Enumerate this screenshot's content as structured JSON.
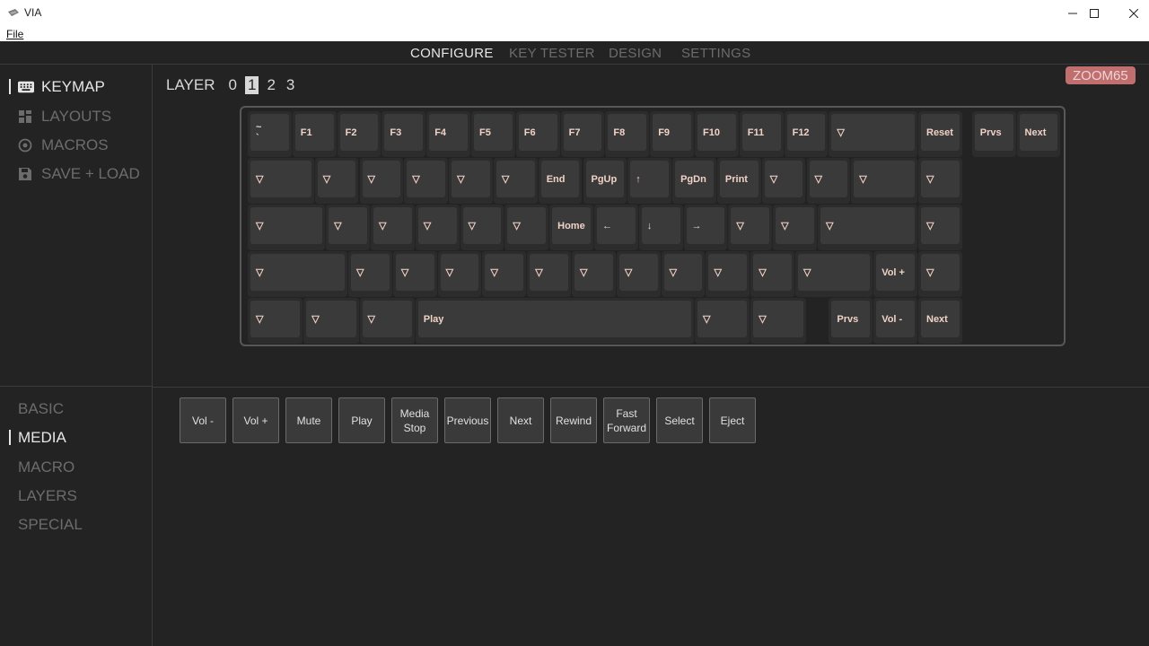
{
  "window": {
    "title": "VIA",
    "minimize": "—",
    "maximize": "☐",
    "close": "✕"
  },
  "menu": {
    "file": "File"
  },
  "topnav": [
    {
      "label": "CONFIGURE",
      "active": true
    },
    {
      "label": "KEY TESTER",
      "active": false
    },
    {
      "label": "DESIGN",
      "active": false
    },
    {
      "label": "SETTINGS",
      "active": false
    }
  ],
  "sidebar_top": [
    {
      "label": "KEYMAP",
      "icon": "keyboard-icon",
      "active": true
    },
    {
      "label": "LAYOUTS",
      "icon": "grid-icon",
      "active": false
    },
    {
      "label": "MACROS",
      "icon": "record-icon",
      "active": false
    },
    {
      "label": "SAVE + LOAD",
      "icon": "floppy-disk-icon",
      "active": false
    }
  ],
  "sidebar_bottom": [
    {
      "label": "BASIC",
      "active": false
    },
    {
      "label": "MEDIA",
      "active": true
    },
    {
      "label": "MACRO",
      "active": false
    },
    {
      "label": "LAYERS",
      "active": false
    },
    {
      "label": "SPECIAL",
      "active": false
    }
  ],
  "layer": {
    "label": "LAYER",
    "numbers": [
      "0",
      "1",
      "2",
      "3"
    ],
    "selected": "1"
  },
  "keyboard_name": "ZOOM65",
  "keyboard": {
    "rows": [
      [
        "~\n`",
        "F1",
        "F2",
        "F3",
        "F4",
        "F5",
        "F6",
        "F7",
        "F8",
        "F9",
        "F10",
        "F11",
        "F12",
        "▽",
        "Reset",
        "Prvs",
        "Next"
      ],
      [
        "▽",
        "▽",
        "▽",
        "▽",
        "▽",
        "▽",
        "End",
        "PgUp",
        "↑",
        "PgDn",
        "Print",
        "▽",
        "▽",
        "▽",
        "▽"
      ],
      [
        "▽",
        "▽",
        "▽",
        "▽",
        "▽",
        "▽",
        "Home",
        "←",
        "↓",
        "→",
        "▽",
        "▽",
        "▽",
        "▽"
      ],
      [
        "▽",
        "▽",
        "▽",
        "▽",
        "▽",
        "▽",
        "▽",
        "▽",
        "▽",
        "▽",
        "▽",
        "▽",
        "Vol +",
        "▽"
      ],
      [
        "▽",
        "▽",
        "▽",
        "Play",
        "▽",
        "▽",
        "Prvs",
        "Vol -",
        "Next"
      ]
    ]
  },
  "media_keys": [
    "Vol -",
    "Vol +",
    "Mute",
    "Play",
    "Media\nStop",
    "Previous",
    "Next",
    "Rewind",
    "Fast\nForward",
    "Select",
    "Eject"
  ]
}
